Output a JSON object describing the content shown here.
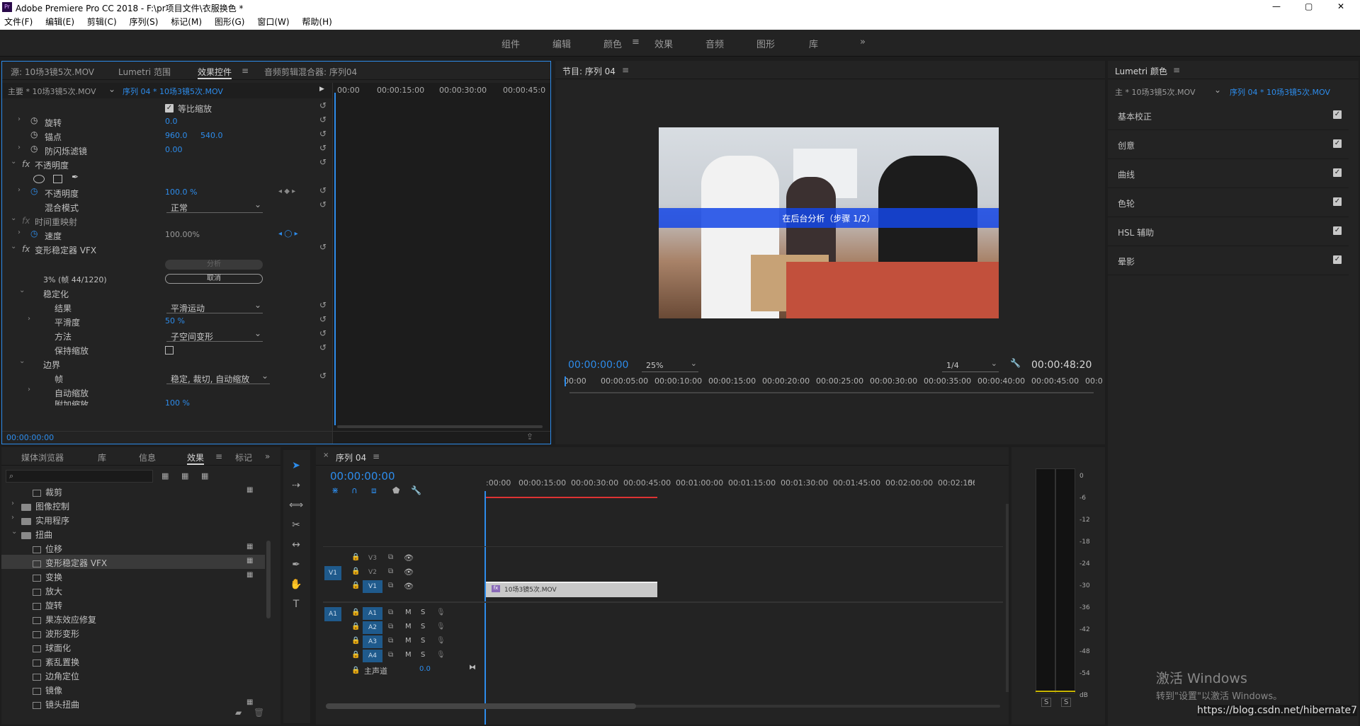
{
  "app": {
    "title": "Adobe Premiere Pro CC 2018 - F:\\pr项目文件\\衣服换色 *",
    "min": "—",
    "max": "▢",
    "close": "✕"
  },
  "menu": [
    "文件(F)",
    "编辑(E)",
    "剪辑(C)",
    "序列(S)",
    "标记(M)",
    "图形(G)",
    "窗口(W)",
    "帮助(H)"
  ],
  "workspaces": [
    "组件",
    "编辑",
    "颜色",
    "效果",
    "音频",
    "图形",
    "库"
  ],
  "workspaces_more": "»",
  "source_panel": {
    "tabs": [
      "源: 10场3镜5次.MOV",
      "Lumetri 范围",
      "效果控件",
      "音频剪辑混合器: 序列04"
    ],
    "master": "主要 * 10场3镜5次.MOV",
    "seq": "序列 04 * 10场3镜5次.MOV",
    "ruler": [
      "00:00",
      "00:00:15:00",
      "00:00:30:00",
      "00:00:45:0"
    ],
    "rows": {
      "uniform": "等比缩放",
      "rotation": "旋转",
      "rotation_val": "0.0",
      "anchor": "锚点",
      "anchor_x": "960.0",
      "anchor_y": "540.0",
      "flicker": "防闪烁滤镜",
      "flicker_val": "0.00",
      "opacity_group": "不透明度",
      "opacity": "不透明度",
      "opacity_val": "100.0 %",
      "blend": "混合模式",
      "blend_val": "正常",
      "time_remap": "时间重映射",
      "speed": "速度",
      "speed_val": "100.00%",
      "warp": "变形稳定器 VFX",
      "analyze_btn": "分析",
      "progress": "3% (帧 44/1220)",
      "cancel_btn": "取消",
      "stabilization": "稳定化",
      "result": "结果",
      "result_val": "平滑运动",
      "smooth": "平滑度",
      "smooth_val": "50 %",
      "method": "方法",
      "method_val": "子空间变形",
      "preserve": "保持缩放",
      "borders": "边界",
      "framing": "帧",
      "framing_val": "稳定, 裁切, 自动缩放",
      "autoscale": "自动缩放",
      "addscale": "附加缩放",
      "addscale_val": "100 %"
    },
    "timecode": "00:00:00:00"
  },
  "program": {
    "title": "节目: 序列 04",
    "caption": "在后台分析（步骤 1/2）",
    "timecode": "00:00:00:00",
    "zoom": "25%",
    "res": "1/4",
    "duration": "00:00:48:20",
    "ruler": [
      "00:00",
      "00:00:05:00",
      "00:00:10:00",
      "00:00:15:00",
      "00:00:20:00",
      "00:00:25:00",
      "00:00:30:00",
      "00:00:35:00",
      "00:00:40:00",
      "00:00:45:00",
      "00:0"
    ]
  },
  "lumetri": {
    "title": "Lumetri 颜色",
    "master": "主 * 10场3镜5次.MOV",
    "seq": "序列 04 * 10场3镜5次.MOV",
    "sections": [
      "基本校正",
      "创意",
      "曲线",
      "色轮",
      "HSL 辅助",
      "晕影"
    ]
  },
  "effects": {
    "tabs": [
      "媒体浏览器",
      "库",
      "信息",
      "效果",
      "标记"
    ],
    "items": [
      {
        "label": "裁剪",
        "kind": "fx",
        "indent": 2
      },
      {
        "label": "图像控制",
        "kind": "folder",
        "indent": 1
      },
      {
        "label": "实用程序",
        "kind": "folder",
        "indent": 1
      },
      {
        "label": "扭曲",
        "kind": "folder",
        "indent": 1
      },
      {
        "label": "位移",
        "kind": "fx",
        "indent": 2
      },
      {
        "label": "变形稳定器 VFX",
        "kind": "fx",
        "indent": 2
      },
      {
        "label": "变换",
        "kind": "fx",
        "indent": 2
      },
      {
        "label": "放大",
        "kind": "fx",
        "indent": 2
      },
      {
        "label": "旋转",
        "kind": "fx",
        "indent": 2
      },
      {
        "label": "果冻效应修复",
        "kind": "fx",
        "indent": 2
      },
      {
        "label": "波形变形",
        "kind": "fx",
        "indent": 2
      },
      {
        "label": "球面化",
        "kind": "fx",
        "indent": 2
      },
      {
        "label": "紊乱置换",
        "kind": "fx",
        "indent": 2
      },
      {
        "label": "边角定位",
        "kind": "fx",
        "indent": 2
      },
      {
        "label": "镜像",
        "kind": "fx",
        "indent": 2
      },
      {
        "label": "镜头扭曲",
        "kind": "fx",
        "indent": 2
      }
    ]
  },
  "timeline": {
    "title": "序列 04",
    "timecode": "00:00:00:00",
    "ruler": [
      ":00:00",
      "00:00:15:00",
      "00:00:30:00",
      "00:00:45:00",
      "00:01:00:00",
      "00:01:15:00",
      "00:01:30:00",
      "00:01:45:00",
      "00:02:00:00",
      "00:02:15:00",
      "00"
    ],
    "video": [
      "V3",
      "V2",
      "V1"
    ],
    "audio": [
      "A1",
      "A2",
      "A3",
      "A4"
    ],
    "src_v": "V1",
    "src_a": "A1",
    "master": "主声道",
    "master_val": "0.0",
    "clip": "10场3镜5次.MOV",
    "m": "M",
    "s": "S"
  },
  "meter": {
    "ticks": [
      "0",
      "-6",
      "-12",
      "-18",
      "-24",
      "-30",
      "-36",
      "-42",
      "-48",
      "-54",
      "dB"
    ],
    "solo": "S"
  },
  "watermark": {
    "line1": "激活 Windows",
    "line2": "转到\"设置\"以激活 Windows。",
    "url": "https://blog.csdn.net/hibernate7"
  },
  "colors": {
    "accent": "#2d8ceb",
    "panel": "#232323",
    "bg": "#1d1d1d"
  }
}
